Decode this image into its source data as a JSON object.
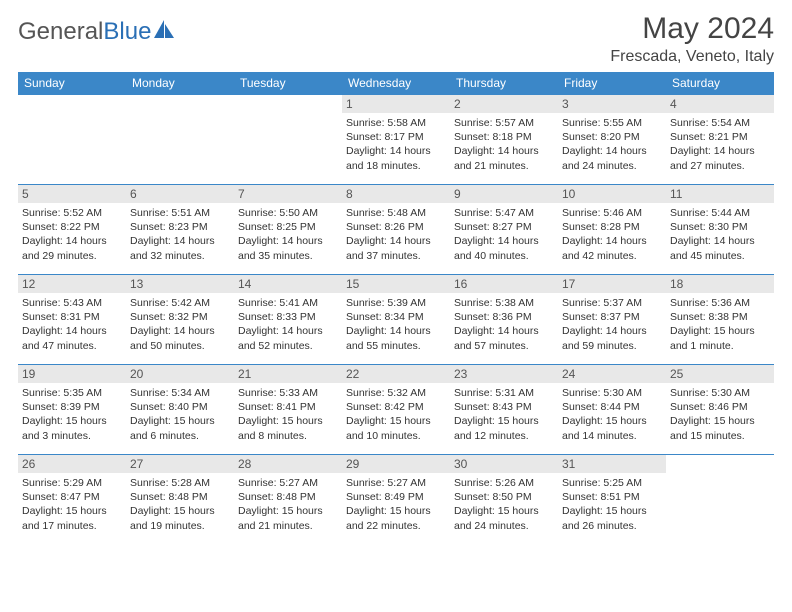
{
  "brand": {
    "part1": "General",
    "part2": "Blue"
  },
  "title": "May 2024",
  "location": "Frescada, Veneto, Italy",
  "day_headers": [
    "Sunday",
    "Monday",
    "Tuesday",
    "Wednesday",
    "Thursday",
    "Friday",
    "Saturday"
  ],
  "weeks": [
    [
      {
        "n": "",
        "sr": "",
        "ss": "",
        "dl": ""
      },
      {
        "n": "",
        "sr": "",
        "ss": "",
        "dl": ""
      },
      {
        "n": "",
        "sr": "",
        "ss": "",
        "dl": ""
      },
      {
        "n": "1",
        "sr": "Sunrise: 5:58 AM",
        "ss": "Sunset: 8:17 PM",
        "dl": "Daylight: 14 hours and 18 minutes."
      },
      {
        "n": "2",
        "sr": "Sunrise: 5:57 AM",
        "ss": "Sunset: 8:18 PM",
        "dl": "Daylight: 14 hours and 21 minutes."
      },
      {
        "n": "3",
        "sr": "Sunrise: 5:55 AM",
        "ss": "Sunset: 8:20 PM",
        "dl": "Daylight: 14 hours and 24 minutes."
      },
      {
        "n": "4",
        "sr": "Sunrise: 5:54 AM",
        "ss": "Sunset: 8:21 PM",
        "dl": "Daylight: 14 hours and 27 minutes."
      }
    ],
    [
      {
        "n": "5",
        "sr": "Sunrise: 5:52 AM",
        "ss": "Sunset: 8:22 PM",
        "dl": "Daylight: 14 hours and 29 minutes."
      },
      {
        "n": "6",
        "sr": "Sunrise: 5:51 AM",
        "ss": "Sunset: 8:23 PM",
        "dl": "Daylight: 14 hours and 32 minutes."
      },
      {
        "n": "7",
        "sr": "Sunrise: 5:50 AM",
        "ss": "Sunset: 8:25 PM",
        "dl": "Daylight: 14 hours and 35 minutes."
      },
      {
        "n": "8",
        "sr": "Sunrise: 5:48 AM",
        "ss": "Sunset: 8:26 PM",
        "dl": "Daylight: 14 hours and 37 minutes."
      },
      {
        "n": "9",
        "sr": "Sunrise: 5:47 AM",
        "ss": "Sunset: 8:27 PM",
        "dl": "Daylight: 14 hours and 40 minutes."
      },
      {
        "n": "10",
        "sr": "Sunrise: 5:46 AM",
        "ss": "Sunset: 8:28 PM",
        "dl": "Daylight: 14 hours and 42 minutes."
      },
      {
        "n": "11",
        "sr": "Sunrise: 5:44 AM",
        "ss": "Sunset: 8:30 PM",
        "dl": "Daylight: 14 hours and 45 minutes."
      }
    ],
    [
      {
        "n": "12",
        "sr": "Sunrise: 5:43 AM",
        "ss": "Sunset: 8:31 PM",
        "dl": "Daylight: 14 hours and 47 minutes."
      },
      {
        "n": "13",
        "sr": "Sunrise: 5:42 AM",
        "ss": "Sunset: 8:32 PM",
        "dl": "Daylight: 14 hours and 50 minutes."
      },
      {
        "n": "14",
        "sr": "Sunrise: 5:41 AM",
        "ss": "Sunset: 8:33 PM",
        "dl": "Daylight: 14 hours and 52 minutes."
      },
      {
        "n": "15",
        "sr": "Sunrise: 5:39 AM",
        "ss": "Sunset: 8:34 PM",
        "dl": "Daylight: 14 hours and 55 minutes."
      },
      {
        "n": "16",
        "sr": "Sunrise: 5:38 AM",
        "ss": "Sunset: 8:36 PM",
        "dl": "Daylight: 14 hours and 57 minutes."
      },
      {
        "n": "17",
        "sr": "Sunrise: 5:37 AM",
        "ss": "Sunset: 8:37 PM",
        "dl": "Daylight: 14 hours and 59 minutes."
      },
      {
        "n": "18",
        "sr": "Sunrise: 5:36 AM",
        "ss": "Sunset: 8:38 PM",
        "dl": "Daylight: 15 hours and 1 minute."
      }
    ],
    [
      {
        "n": "19",
        "sr": "Sunrise: 5:35 AM",
        "ss": "Sunset: 8:39 PM",
        "dl": "Daylight: 15 hours and 3 minutes."
      },
      {
        "n": "20",
        "sr": "Sunrise: 5:34 AM",
        "ss": "Sunset: 8:40 PM",
        "dl": "Daylight: 15 hours and 6 minutes."
      },
      {
        "n": "21",
        "sr": "Sunrise: 5:33 AM",
        "ss": "Sunset: 8:41 PM",
        "dl": "Daylight: 15 hours and 8 minutes."
      },
      {
        "n": "22",
        "sr": "Sunrise: 5:32 AM",
        "ss": "Sunset: 8:42 PM",
        "dl": "Daylight: 15 hours and 10 minutes."
      },
      {
        "n": "23",
        "sr": "Sunrise: 5:31 AM",
        "ss": "Sunset: 8:43 PM",
        "dl": "Daylight: 15 hours and 12 minutes."
      },
      {
        "n": "24",
        "sr": "Sunrise: 5:30 AM",
        "ss": "Sunset: 8:44 PM",
        "dl": "Daylight: 15 hours and 14 minutes."
      },
      {
        "n": "25",
        "sr": "Sunrise: 5:30 AM",
        "ss": "Sunset: 8:46 PM",
        "dl": "Daylight: 15 hours and 15 minutes."
      }
    ],
    [
      {
        "n": "26",
        "sr": "Sunrise: 5:29 AM",
        "ss": "Sunset: 8:47 PM",
        "dl": "Daylight: 15 hours and 17 minutes."
      },
      {
        "n": "27",
        "sr": "Sunrise: 5:28 AM",
        "ss": "Sunset: 8:48 PM",
        "dl": "Daylight: 15 hours and 19 minutes."
      },
      {
        "n": "28",
        "sr": "Sunrise: 5:27 AM",
        "ss": "Sunset: 8:48 PM",
        "dl": "Daylight: 15 hours and 21 minutes."
      },
      {
        "n": "29",
        "sr": "Sunrise: 5:27 AM",
        "ss": "Sunset: 8:49 PM",
        "dl": "Daylight: 15 hours and 22 minutes."
      },
      {
        "n": "30",
        "sr": "Sunrise: 5:26 AM",
        "ss": "Sunset: 8:50 PM",
        "dl": "Daylight: 15 hours and 24 minutes."
      },
      {
        "n": "31",
        "sr": "Sunrise: 5:25 AM",
        "ss": "Sunset: 8:51 PM",
        "dl": "Daylight: 15 hours and 26 minutes."
      },
      {
        "n": "",
        "sr": "",
        "ss": "",
        "dl": ""
      }
    ]
  ]
}
